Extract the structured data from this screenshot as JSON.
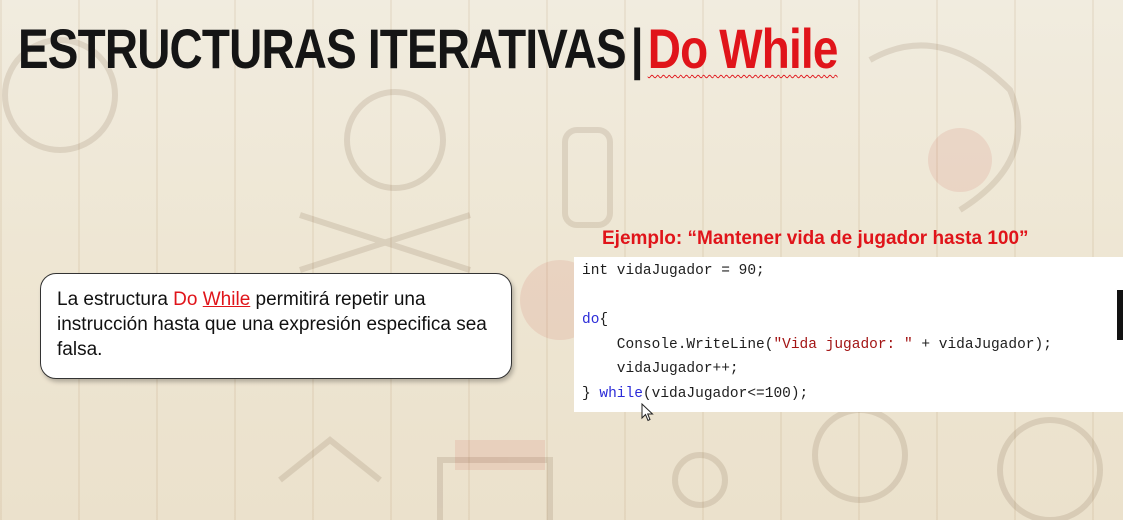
{
  "slide": {
    "title_main": "ESTRUCTURAS ITERATIVAS",
    "title_separator": "|",
    "title_accent": "Do While",
    "example_heading": "Ejemplo: “Mantener vida de jugador hasta 100”",
    "callout": {
      "before": "La estructura ",
      "do": "Do",
      "while": "While",
      "after": " permitirá repetir una instrucción hasta que una expresión especifica sea falsa."
    },
    "code": {
      "line1": "int vidaJugador = 90;",
      "line3_kw": "do",
      "line3_rest": "{",
      "line4_a": "    Console.WriteLine(",
      "line4_str": "\"Vida jugador: \"",
      "line4_b": " + vidaJugador);",
      "line5": "    vidaJugador++;",
      "line6_a": "} ",
      "line6_kw": "while",
      "line6_b": "(vidaJugador<=100);"
    },
    "colors": {
      "accent": "#e0141a",
      "title": "#151515",
      "keyword": "#2b2bd8",
      "string": "#a31515"
    },
    "icons": {
      "cursor": "mouse-pointer-icon"
    }
  }
}
